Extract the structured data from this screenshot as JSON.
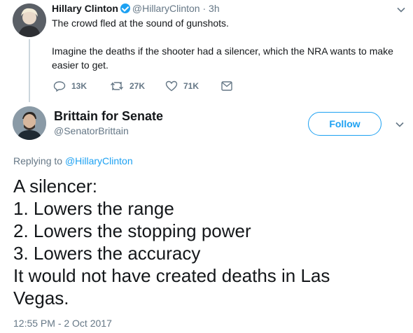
{
  "quoted_tweet": {
    "author_name": "Hillary Clinton",
    "author_handle": "@HillaryClinton",
    "separator": "·",
    "time": "3h",
    "text_line1": "The crowd fled at the sound of gunshots.",
    "text_line2": "Imagine the deaths if the shooter had a silencer, which the NRA wants to make",
    "text_line3": "easier to get.",
    "actions": {
      "reply_icon": "reply-icon",
      "reply_count": "13K",
      "retweet_icon": "retweet-icon",
      "retweet_count": "27K",
      "like_icon": "heart-icon",
      "like_count": "71K",
      "dm_icon": "envelope-icon"
    }
  },
  "main_tweet": {
    "author_name": "Brittain for Senate",
    "author_handle": "@SenatorBrittain",
    "follow_label": "Follow",
    "replying_prefix": "Replying to",
    "replying_handle": "@HillaryClinton",
    "lines": [
      "A silencer:",
      "1. Lowers the range",
      "2. Lowers the stopping power",
      "3. Lowers the accuracy",
      "It would not have created deaths in Las",
      "Vegas."
    ],
    "timestamp": "12:55 PM - 2 Oct 2017"
  },
  "colors": {
    "accent": "#1da1f2",
    "muted": "#657786",
    "text": "#14171a"
  }
}
